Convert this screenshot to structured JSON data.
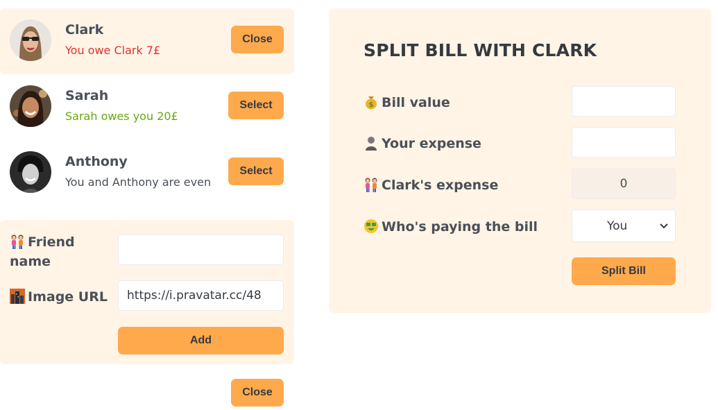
{
  "friends": [
    {
      "name": "Clark",
      "status": "You owe Clark 7£",
      "button": "Close"
    },
    {
      "name": "Sarah",
      "status": "Sarah owes you 20£",
      "button": "Select"
    },
    {
      "name": "Anthony",
      "status": "You and Anthony are even",
      "button": "Select"
    }
  ],
  "add_form": {
    "friend_name_label": "Friend name",
    "friend_name_value": "",
    "image_url_label": "Image URL",
    "image_url_value": "https://i.pravatar.cc/48",
    "add_button": "Add"
  },
  "close_button": "Close",
  "split_form": {
    "title": "SPLIT BILL WITH CLARK",
    "bill_value_label": "Bill value",
    "bill_value": "",
    "your_expense_label": "Your expense",
    "your_expense": "",
    "friend_expense_label": "Clark's expense",
    "friend_expense": "0",
    "payer_label": "Who's paying the bill",
    "payer_selected": "You",
    "submit_button": "Split Bill"
  },
  "icons": {
    "friend_name": "women-holding-hands-icon",
    "image_url": "cityscape-icon",
    "bill_value": "money-bag-icon",
    "your_expense": "person-icon",
    "friend_expense": "women-holding-hands-icon",
    "payer": "money-mouth-face-icon"
  },
  "colors": {
    "accent": "#ffa94d",
    "panel": "#fff4e6",
    "owe": "#e03131",
    "owed": "#66a80f"
  }
}
